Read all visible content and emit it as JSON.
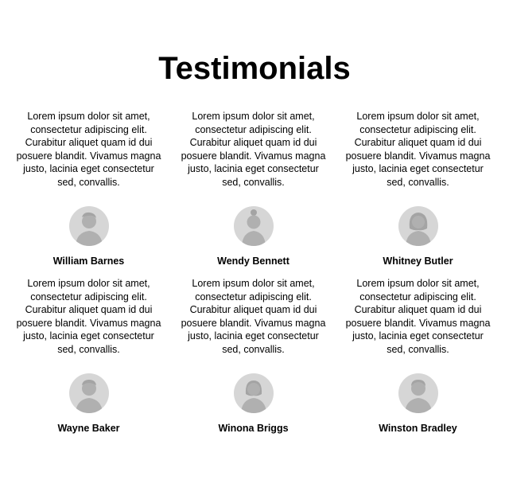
{
  "header": {
    "title": "Testimonials"
  },
  "colors": {
    "avatar_bg": "#d6d6d6",
    "avatar_figure": "#b0b0b0"
  },
  "testimonials": [
    {
      "quote": "Lorem ipsum dolor sit amet, consectetur adipiscing elit. Curabitur aliquet quam id dui posuere blandit. Vivamus magna justo, lacinia eget consectetur sed, convallis.",
      "name": "William Barnes",
      "avatar_icon": "male-avatar-icon"
    },
    {
      "quote": "Lorem ipsum dolor sit amet, consectetur adipiscing elit. Curabitur aliquet quam id dui posuere blandit. Vivamus magna justo, lacinia eget consectetur sed, convallis.",
      "name": "Wendy Bennett",
      "avatar_icon": "female-avatar-icon"
    },
    {
      "quote": "Lorem ipsum dolor sit amet, consectetur adipiscing elit. Curabitur aliquet quam id dui posuere blandit. Vivamus magna justo, lacinia eget consectetur sed, convallis.",
      "name": "Whitney Butler",
      "avatar_icon": "female-avatar-icon"
    },
    {
      "quote": "Lorem ipsum dolor sit amet, consectetur adipiscing elit. Curabitur aliquet quam id dui posuere blandit. Vivamus magna justo, lacinia eget consectetur sed, convallis.",
      "name": "Wayne Baker",
      "avatar_icon": "male-avatar-icon"
    },
    {
      "quote": "Lorem ipsum dolor sit amet, consectetur adipiscing elit. Curabitur aliquet quam id dui posuere blandit. Vivamus magna justo, lacinia eget consectetur sed, convallis.",
      "name": "Winona Briggs",
      "avatar_icon": "female-avatar-icon"
    },
    {
      "quote": "Lorem ipsum dolor sit amet, consectetur adipiscing elit. Curabitur aliquet quam id dui posuere blandit. Vivamus magna justo, lacinia eget consectetur sed, convallis.",
      "name": "Winston Bradley",
      "avatar_icon": "male-avatar-icon"
    }
  ]
}
